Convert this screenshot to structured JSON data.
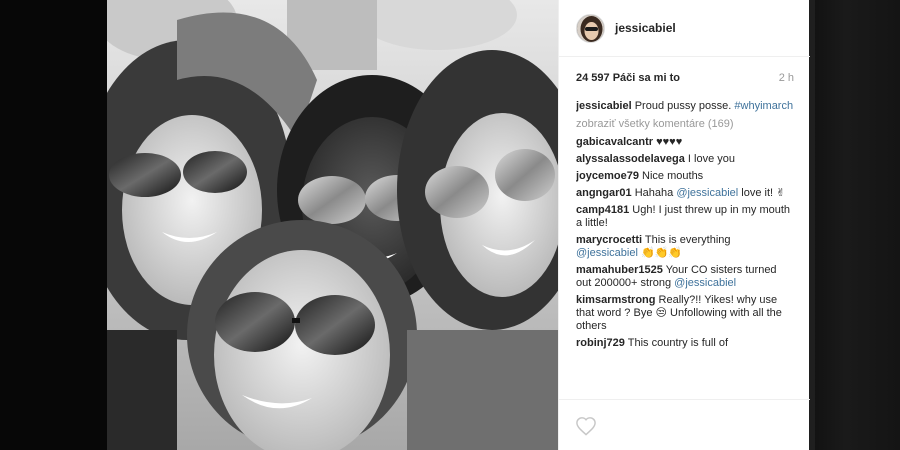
{
  "post": {
    "username": "jessicabiel",
    "likes_text": "24 597 Páči sa mi to",
    "time_ago": "2 h",
    "caption": {
      "user": "jessicabiel",
      "text": "Proud pussy posse.",
      "hashtag": "#whyimarch"
    },
    "view_all_comments": "zobraziť všetky komentáre (169)",
    "comments": [
      {
        "user": "gabicavalcantr",
        "text": "♥♥♥♥"
      },
      {
        "user": "alyssalassodelavega",
        "text": "I love you"
      },
      {
        "user": "joycemoe79",
        "text": "Nice mouths"
      },
      {
        "user": "angngar01",
        "text": "Hahaha",
        "mention": "@jessicabiel",
        "after": "love it! ✌"
      },
      {
        "user": "camp4181",
        "text": "Ugh! I just threw up in my mouth a little!"
      },
      {
        "user": "marycrocetti",
        "text": "This is everything",
        "mention": "@jessicabiel",
        "after": "👏👏👏"
      },
      {
        "user": "mamahuber1525",
        "text": "Your CO sisters turned out 200000+ strong",
        "mention": "@jessicabiel",
        "after": ""
      },
      {
        "user": "kimsarmstrong",
        "text": "Really?!! Yikes! why use that word ? Bye 😒 Unfollowing with all the others"
      },
      {
        "user": "robinj729",
        "text": "This country is full of"
      }
    ]
  },
  "icons": {
    "heart": "heart-outline-icon",
    "scroll_up": "▲",
    "scroll_down": "▼"
  },
  "colors": {
    "link": "#3f729b",
    "text": "#262626",
    "muted": "#999999"
  }
}
